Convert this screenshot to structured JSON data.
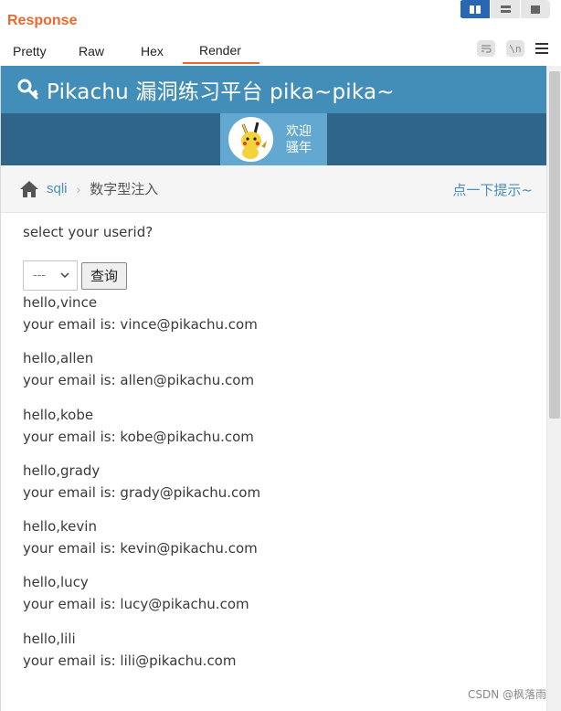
{
  "response_panel": {
    "title": "Response",
    "tabs": [
      {
        "label": "Pretty"
      },
      {
        "label": "Raw"
      },
      {
        "label": "Hex"
      },
      {
        "label": "Render"
      }
    ],
    "active_tab": "Render",
    "toolbar": {
      "wrap_icon": "wrap-icon",
      "newline_label": "\\n",
      "menu_icon": "hamburger-icon"
    },
    "accent_color": "#e8692d"
  },
  "page": {
    "brand": "Pikachu 漏洞练习平台 pika~pika~",
    "welcome_line1": "欢迎",
    "welcome_line2": "骚年",
    "breadcrumb": {
      "link": "sqli",
      "separator": "›",
      "current": "数字型注入"
    },
    "hint_link": "点一下提示~",
    "question": "select your userid?",
    "select_value": "---",
    "query_button": "查询",
    "results": [
      {
        "hello": "hello,vince",
        "email": "your email is: vince@pikachu.com"
      },
      {
        "hello": "hello,allen",
        "email": "your email is: allen@pikachu.com"
      },
      {
        "hello": "hello,kobe",
        "email": "your email is: kobe@pikachu.com"
      },
      {
        "hello": "hello,grady",
        "email": "your email is: grady@pikachu.com"
      },
      {
        "hello": "hello,kevin",
        "email": "your email is: kevin@pikachu.com"
      },
      {
        "hello": "hello,lucy",
        "email": "your email is: lucy@pikachu.com"
      },
      {
        "hello": "hello,lili",
        "email": "your email is: lili@pikachu.com"
      }
    ],
    "navbar_color": "#438eb9",
    "userbar_color": "#2e6589"
  },
  "watermark": "CSDN @枫落雨"
}
